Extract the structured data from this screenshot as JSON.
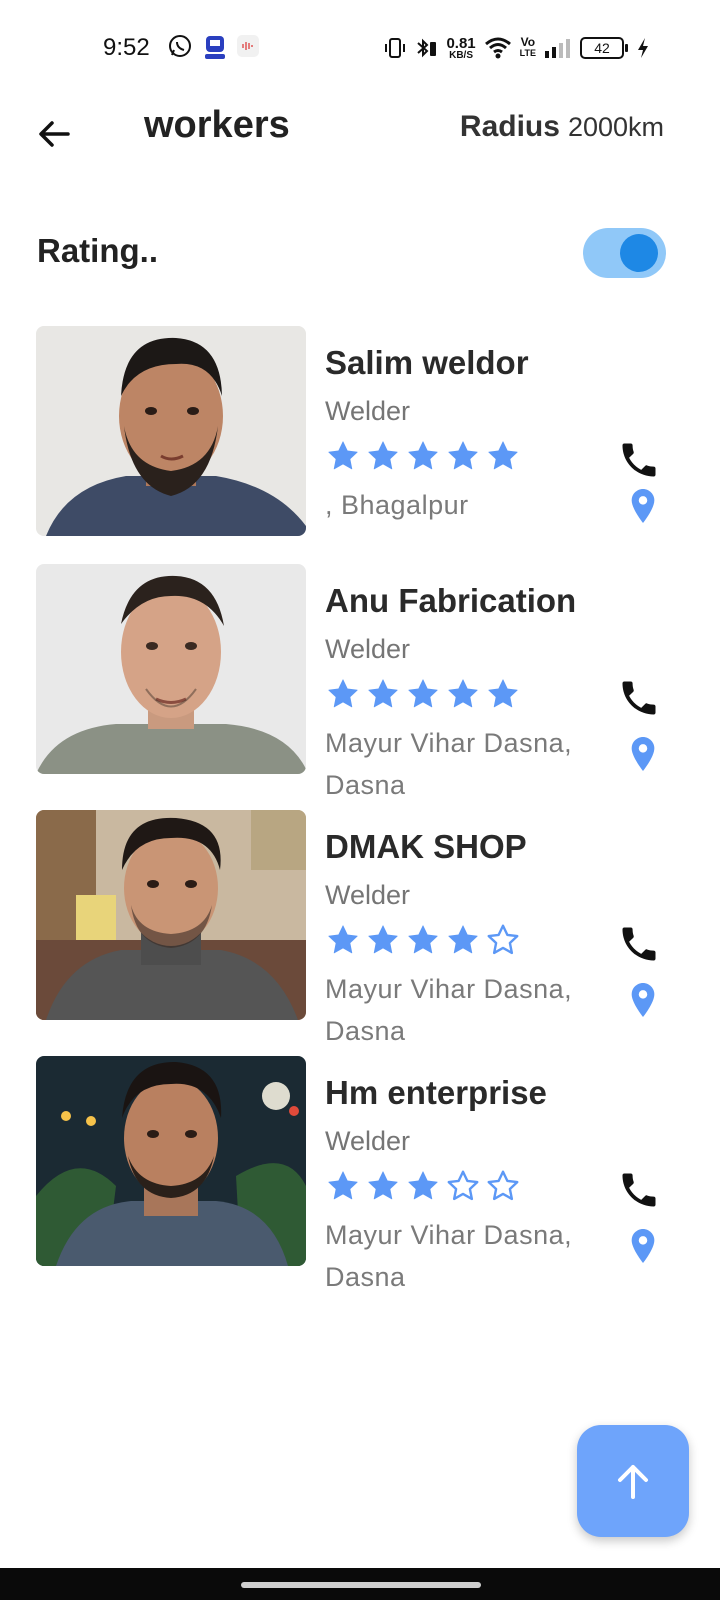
{
  "status_bar": {
    "time": "9:52",
    "net_speed_value": "0.81",
    "net_speed_unit": "KB/S",
    "volte_label_top": "Vo",
    "volte_label_bottom": "LTE",
    "battery_level": "42"
  },
  "header": {
    "title": "workers",
    "radius_label": "Radius",
    "radius_value": "2000km"
  },
  "filter": {
    "label": "Rating..",
    "toggle_on": true
  },
  "colors": {
    "accent": "#6ea4fb",
    "star": "#5c98f6",
    "toggle_track": "#90c8f8",
    "toggle_knob": "#1e88e5",
    "pin": "#5c98f6"
  },
  "workers": [
    {
      "name": "Salim weldor",
      "trade": "Welder",
      "rating": 5,
      "location": ", Bhagalpur"
    },
    {
      "name": "Anu Fabrication",
      "trade": "Welder",
      "rating": 5,
      "location": "Mayur Vihar Dasna, Dasna"
    },
    {
      "name": "DMAK SHOP",
      "trade": "Welder",
      "rating": 4,
      "location": "Mayur Vihar Dasna, Dasna"
    },
    {
      "name": "Hm enterprise",
      "trade": "Welder",
      "rating": 3,
      "location": "Mayur Vihar Dasna, Dasna"
    }
  ],
  "icons": {
    "back": "arrow-left-icon",
    "call": "phone-icon",
    "map": "location-pin-icon",
    "fab": "arrow-up-icon",
    "star_filled": "star-filled-icon",
    "star_empty": "star-outline-icon"
  }
}
